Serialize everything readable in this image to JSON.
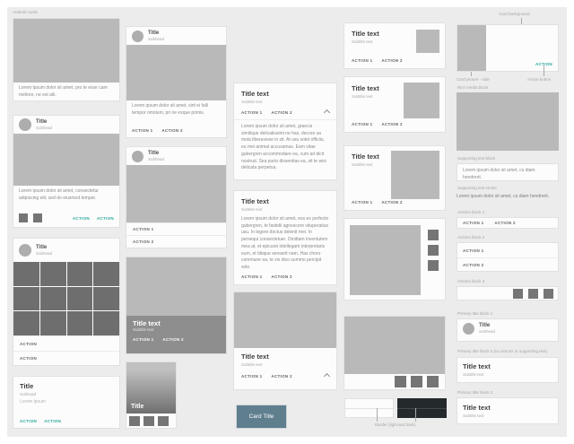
{
  "page": {
    "title": "Android cards"
  },
  "colors": {
    "accent": "#26a69a",
    "slate": "#5f7e8e"
  },
  "col1": {
    "card1": {
      "body": "Lorem ipsum dolor sit amet, pro te esse care meliore, ne est alii."
    },
    "card2": {
      "title": "Title",
      "subhead": "Subhead",
      "body": "Lorem ipsum dolor sit amet, consectetur adipiscing elit, sed do eiusmod tempor.",
      "action1": "ACTION",
      "action2": "ACTION"
    },
    "card3": {
      "title": "Title",
      "subhead": "Subhead",
      "action1": "ACTION",
      "action2": "ACTION"
    },
    "card4": {
      "title": "Title",
      "subhead": "Subhead",
      "body": "Lorem ipsum",
      "action1": "ACTION",
      "action2": "ACTION"
    }
  },
  "col2": {
    "card1": {
      "title": "Title",
      "subhead": "Subhead",
      "body": "Lorem ipsum dolor sit amet, sint ei falli tempor omnium, pri ne exque primis.",
      "action1": "ACTION 1",
      "action2": "ACTION 2"
    },
    "card2": {
      "title": "Title",
      "subhead": "Subhead",
      "action1": "ACTION 1",
      "action2": "ACTION 2"
    },
    "card3": {
      "title": "Title text",
      "subtitle": "Subtitle text",
      "action1": "ACTION 1",
      "action2": "ACTION 2"
    },
    "card4": {
      "title": "Title"
    }
  },
  "col3": {
    "card1": {
      "title": "Title text",
      "subtitle": "Subtitle text",
      "action1": "ACTION 1",
      "action2": "ACTION 2",
      "body": "Lorem ipsum dolor sit amet, graecis similique delicatissimi ne has, decore sa mola liberavisse in sit. At usu solet officiis, eu mei animal accusamus. Eam vitae gubergren accommodare ea, cum ad dicit nostrud. Sea purto dissentias ea, sit te wisi delicata perpetua."
    },
    "card2": {
      "title": "Title text",
      "subtitle": "Subtitle text",
      "body": "Lorem ipsum dolor sit amet, eos ex perfecto gubergren, te fastidii agnoscere vituperatius usu. In legere doctus delenit mei. In persequi consectetuer. Omittam inventutem mea at, et epicurei intellegam interpretaris eum, et tibique senserit nam. Has choro commune ea, te vix dico summo percipit sole.",
      "action1": "ACTION 1",
      "action2": "ACTION 2"
    },
    "card3": {
      "title": "Title text",
      "subtitle": "Subtitle text",
      "action1": "ACTION 1",
      "action2": "ACTION 2"
    },
    "button": {
      "label": "Card Title"
    }
  },
  "col4": {
    "card1": {
      "title": "Title text",
      "subtitle": "Subtitle text",
      "action1": "ACTION 1",
      "action2": "ACTION 2"
    },
    "card2": {
      "title": "Title text",
      "subtitle": "Subtitle text",
      "action1": "ACTION 1",
      "action2": "ACTION 2"
    },
    "card3": {
      "title": "Title text",
      "subtitle": "Subtitle text",
      "action1": "ACTION 1",
      "action2": "ACTION 2"
    },
    "divider_label": "Divider (light and dark)"
  },
  "col5": {
    "annotations": {
      "card_background": "Card background",
      "card_picture_side": "Card picture - side",
      "action_button": "Action button",
      "rich_media_block": "Rich media block",
      "supporting_text_block": "Supporting text block",
      "supporting_text_stroke": "Supporting text stroke",
      "actions_block_1": "Actions block 1",
      "actions_block_2": "Actions block 2",
      "actions_block_3": "Actions block 3",
      "primary_title_block_1": "Primary title block 1",
      "primary_title_block_2": "Primary title block 2 (no actions or supporting text)",
      "primary_title_block_3": "Primary title block 3"
    },
    "sample_card": {
      "action": "ACTION"
    },
    "supporting_block_text": "Lorem ipsum dolor sit amet, cu diam hendrerit.",
    "supporting_stroke_text": "Lorem ipsum dolor sit amet, cu diam hendrerit.",
    "actions1": {
      "action1": "ACTION 1",
      "action2": "ACTION 2"
    },
    "actions2": {
      "action1": "ACTION 1",
      "action2": "ACTION 2"
    },
    "title_block1": {
      "title": "Title",
      "subhead": "Subhead"
    },
    "title_block2": {
      "title": "Title text",
      "subtitle": "Subtitle text"
    },
    "title_block3": {
      "title": "Title text",
      "subtitle": "Subtitle text"
    }
  }
}
